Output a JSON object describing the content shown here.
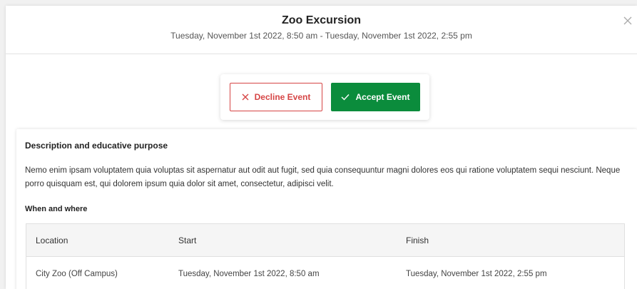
{
  "event": {
    "title": "Zoo Excursion",
    "date_range": "Tuesday, November 1st 2022, 8:50 am - Tuesday, November 1st 2022, 2:55 pm"
  },
  "actions": {
    "decline_label": "Decline Event",
    "decline_icon": "x-icon",
    "accept_label": "Accept Event",
    "accept_icon": "check-icon"
  },
  "details": {
    "heading": "Description and educative purpose",
    "description": "Nemo enim ipsam voluptatem quia voluptas sit aspernatur aut odit aut fugit, sed quia consequuntur magni dolores eos qui ratione voluptatem sequi nesciunt. Neque porro quisquam est, qui dolorem ipsum quia dolor sit amet, consectetur, adipisci velit.",
    "when_where_heading": "When and where",
    "table": {
      "headers": [
        "Location",
        "Start",
        "Finish"
      ],
      "rows": [
        [
          "City Zoo (Off Campus)",
          "Tuesday, November 1st 2022, 8:50 am",
          "Tuesday, November 1st 2022, 2:55 pm"
        ]
      ]
    }
  },
  "colors": {
    "decline": "#d64545",
    "accept": "#0b8c3c"
  }
}
